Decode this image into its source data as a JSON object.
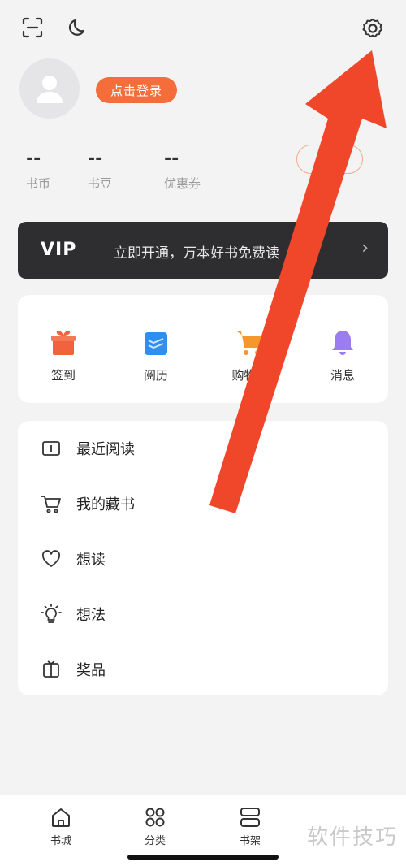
{
  "header": {
    "login_label": "点击登录"
  },
  "stats": [
    {
      "value": "--",
      "label": "书币"
    },
    {
      "value": "--",
      "label": "书豆"
    },
    {
      "value": "--",
      "label": "优惠券"
    }
  ],
  "vip": {
    "logo": "VIP",
    "text": "立即开通，万本好书免费读",
    "arrow": "›"
  },
  "quick_actions": [
    {
      "label": "签到",
      "icon": "gift-icon",
      "color": "#f0633d"
    },
    {
      "label": "阅历",
      "icon": "reading-history-icon",
      "color": "#2f8ef0"
    },
    {
      "label": "购物车",
      "icon": "cart-icon",
      "color": "#f6972c"
    },
    {
      "label": "消息",
      "icon": "bell-icon",
      "color": "#9b7cf2"
    }
  ],
  "menu_items": [
    {
      "label": "最近阅读",
      "icon": "open-book-icon"
    },
    {
      "label": "我的藏书",
      "icon": "cart-outline-icon"
    },
    {
      "label": "想读",
      "icon": "heart-icon"
    },
    {
      "label": "想法",
      "icon": "lightbulb-icon"
    },
    {
      "label": "奖品",
      "icon": "prize-box-icon"
    }
  ],
  "tabs": [
    {
      "label": "书城",
      "icon": "home-icon"
    },
    {
      "label": "分类",
      "icon": "category-grid-icon"
    },
    {
      "label": "书架",
      "icon": "bookshelf-icon"
    }
  ],
  "watermark": "软件技巧",
  "colors": {
    "accent": "#f46d3b",
    "arrow_red": "#f0472b",
    "vip_bg": "#2e2e31"
  }
}
